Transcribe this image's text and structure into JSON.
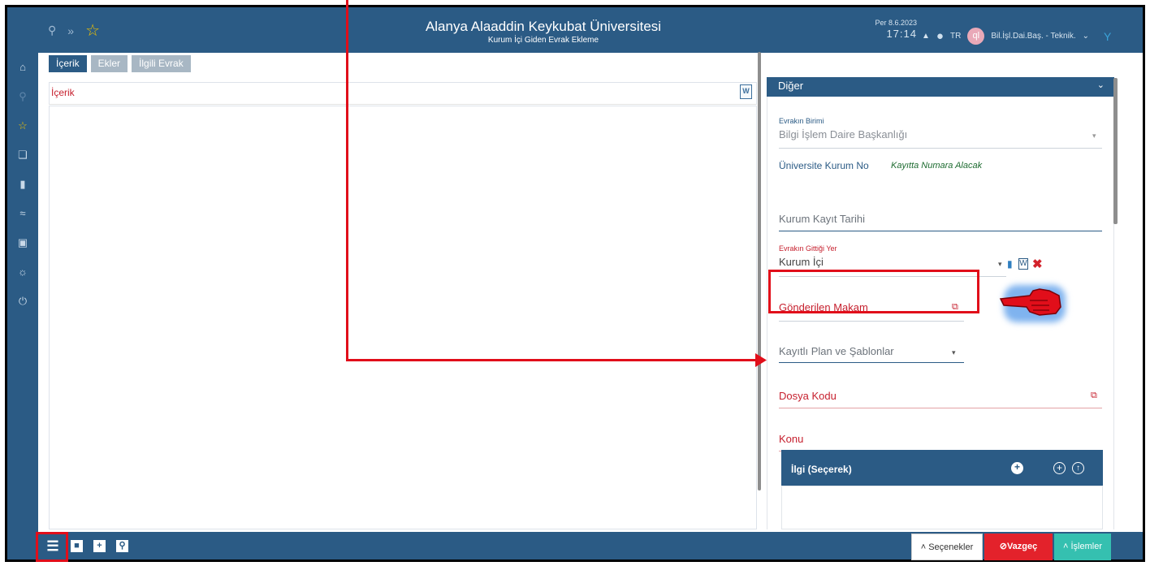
{
  "header": {
    "title": "Alanya Alaaddin Keykubat Üniversitesi",
    "subtitle": "Kurum İçi Giden Evrak Ekleme",
    "date": "Per 8.6.2023",
    "time": "17:14",
    "language": "TR",
    "avatar_letter": "ql",
    "user": "Bil.İşl.Dai.Baş. - Teknik."
  },
  "tabs": [
    "İçerik",
    "Ekler",
    "İlgili Evrak"
  ],
  "editor": {
    "label": "İçerik",
    "word_badge": "W"
  },
  "right_panel": {
    "section_title": "Diğer",
    "evrakin_birimi_label": "Evrakın Birimi",
    "evrakin_birimi_value": "Bilgi İşlem Daire Başkanlığı",
    "universite_kurum_no_label": "Üniversite Kurum No",
    "universite_kurum_no_value": "Kayıtta Numara Alacak",
    "kurum_kayit_tarihi": "Kurum Kayıt Tarihi",
    "evrakin_gittigi_yer_label": "Evrakın Gittiği Yer",
    "evrakin_gittigi_yer_value": "Kurum İçi",
    "gonderilen_makam": "Gönderilen Makam",
    "kayitli_plan": "Kayıtlı Plan ve Şablonlar",
    "dosya_kodu": "Dosya Kodu",
    "konu": "Konu",
    "ilgi_title": "İlgi (Seçerek)"
  },
  "bottom": {
    "secenekler": "Seçenekler",
    "vazgec": "Vazgeç",
    "islemler": "İşlemler"
  },
  "colors": {
    "primary": "#2b5b85",
    "required_red": "#c6202e",
    "highlight_red": "#e10e1a",
    "cancel_red": "#e3222b",
    "teal": "#35c0b0"
  }
}
